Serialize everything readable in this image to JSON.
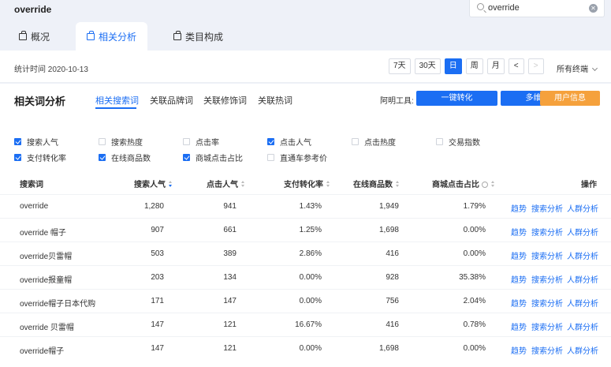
{
  "app": {
    "title": "override"
  },
  "search": {
    "value": "override"
  },
  "nav": {
    "tabs": [
      "概况",
      "相关分析",
      "类目构成"
    ]
  },
  "stats": {
    "time_label": "统计时间 2020-10-13",
    "periods": [
      "7天",
      "30天",
      "日",
      "周",
      "月"
    ],
    "prev": "<",
    "next": ">",
    "terminal": "所有终端"
  },
  "section": {
    "title": "相关词分析",
    "subtabs": [
      "相关搜索词",
      "关联品牌词",
      "关联修饰词",
      "关联热词"
    ],
    "tools_label": "阿明工具:",
    "tool_buttons": [
      "一键转化",
      "多维转化",
      "用户信息"
    ]
  },
  "colors": {
    "accent": "#1b6ef3",
    "orange": "#f5a13c"
  },
  "metrics": [
    {
      "label": "搜索人气",
      "checked": true
    },
    {
      "label": "搜索热度",
      "checked": false
    },
    {
      "label": "点击率",
      "checked": false
    },
    {
      "label": "点击人气",
      "checked": true
    },
    {
      "label": "点击热度",
      "checked": false
    },
    {
      "label": "交易指数",
      "checked": false
    },
    {
      "label": "支付转化率",
      "checked": true
    },
    {
      "label": "在线商品数",
      "checked": true
    },
    {
      "label": "商城点击占比",
      "checked": true
    },
    {
      "label": "直通车参考价",
      "checked": false
    }
  ],
  "table": {
    "headers": [
      "搜索词",
      "搜索人气",
      "点击人气",
      "支付转化率",
      "在线商品数",
      "商城点击占比",
      "操作"
    ],
    "actions": [
      "趋势",
      "搜索分析",
      "人群分析"
    ],
    "rows": [
      [
        "override",
        "1,280",
        "941",
        "1.43%",
        "1,949",
        "1.79%"
      ],
      [
        "override 帽子",
        "907",
        "661",
        "1.25%",
        "1,698",
        "0.00%"
      ],
      [
        "override贝雷帽",
        "503",
        "389",
        "2.86%",
        "416",
        "0.00%"
      ],
      [
        "override报童帽",
        "203",
        "134",
        "0.00%",
        "928",
        "35.38%"
      ],
      [
        "override帽子日本代购",
        "171",
        "147",
        "0.00%",
        "756",
        "2.04%"
      ],
      [
        "override 贝雷帽",
        "147",
        "121",
        "16.67%",
        "416",
        "0.78%"
      ],
      [
        "override帽子",
        "147",
        "121",
        "0.00%",
        "1,698",
        "0.00%"
      ]
    ]
  }
}
